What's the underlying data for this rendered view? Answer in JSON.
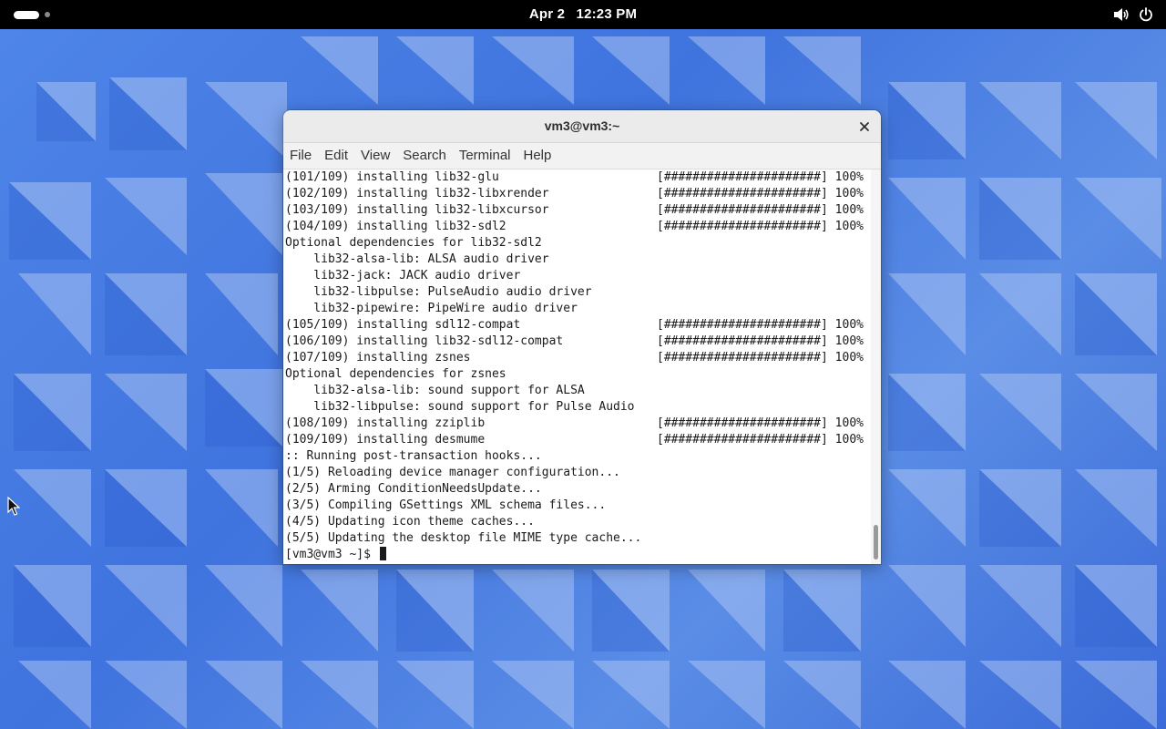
{
  "topbar": {
    "date": "Apr 2",
    "time": "12:23 PM",
    "icons": [
      "activities-icon",
      "volume-icon",
      "power-icon"
    ]
  },
  "window": {
    "title": "vm3@vm3:~",
    "close_icon": "close-icon"
  },
  "menu": [
    "File",
    "Edit",
    "View",
    "Search",
    "Terminal",
    "Help"
  ],
  "terminal": {
    "lines": [
      {
        "text": "(101/109) installing lib32-glu",
        "bar": "[######################] 100%"
      },
      {
        "text": "(102/109) installing lib32-libxrender",
        "bar": "[######################] 100%"
      },
      {
        "text": "(103/109) installing lib32-libxcursor",
        "bar": "[######################] 100%"
      },
      {
        "text": "(104/109) installing lib32-sdl2",
        "bar": "[######################] 100%"
      },
      {
        "text": "Optional dependencies for lib32-sdl2",
        "bar": ""
      },
      {
        "text": "    lib32-alsa-lib: ALSA audio driver",
        "bar": ""
      },
      {
        "text": "    lib32-jack: JACK audio driver",
        "bar": ""
      },
      {
        "text": "    lib32-libpulse: PulseAudio audio driver",
        "bar": ""
      },
      {
        "text": "    lib32-pipewire: PipeWire audio driver",
        "bar": ""
      },
      {
        "text": "(105/109) installing sdl12-compat",
        "bar": "[######################] 100%"
      },
      {
        "text": "(106/109) installing lib32-sdl12-compat",
        "bar": "[######################] 100%"
      },
      {
        "text": "(107/109) installing zsnes",
        "bar": "[######################] 100%"
      },
      {
        "text": "Optional dependencies for zsnes",
        "bar": ""
      },
      {
        "text": "    lib32-alsa-lib: sound support for ALSA",
        "bar": ""
      },
      {
        "text": "    lib32-libpulse: sound support for Pulse Audio",
        "bar": ""
      },
      {
        "text": "(108/109) installing zziplib",
        "bar": "[######################] 100%"
      },
      {
        "text": "(109/109) installing desmume",
        "bar": "[######################] 100%"
      },
      {
        "text": ":: Running post-transaction hooks...",
        "bar": ""
      },
      {
        "text": "(1/5) Reloading device manager configuration...",
        "bar": ""
      },
      {
        "text": "(2/5) Arming ConditionNeedsUpdate...",
        "bar": ""
      },
      {
        "text": "(3/5) Compiling GSettings XML schema files...",
        "bar": ""
      },
      {
        "text": "(4/5) Updating icon theme caches...",
        "bar": ""
      },
      {
        "text": "(5/5) Updating the desktop file MIME type cache...",
        "bar": ""
      }
    ],
    "prompt": "[vm3@vm3 ~]$ "
  },
  "colors": {
    "topbar": "#000000",
    "desktop_blue": "#4f86e8",
    "terminal_bg": "#ffffff",
    "terminal_fg": "#1a1a1a"
  }
}
